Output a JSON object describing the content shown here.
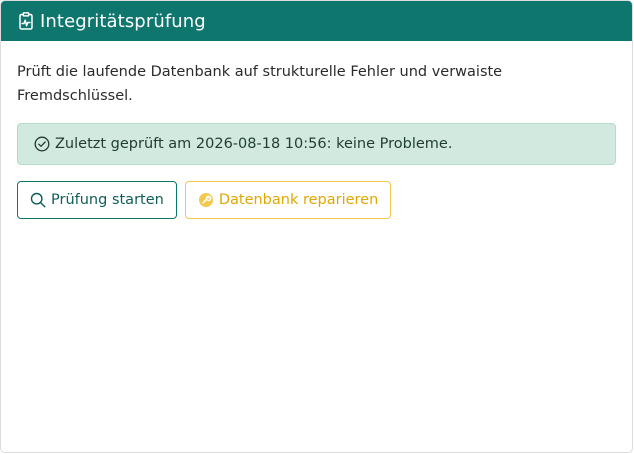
{
  "header": {
    "title": "Integritätsprüfung",
    "icon": "clipboard-pulse-icon",
    "background_color": "#0f766e"
  },
  "body": {
    "description": "Prüft die laufende Datenbank auf strukturelle Fehler und verwaiste Fremdschlüssel."
  },
  "status_alert": {
    "icon": "check-circle-icon",
    "text": "Zuletzt geprüft am 2026-08-18 10:56: keine Probleme.",
    "background_color": "#d1e9de"
  },
  "actions": {
    "start_check": {
      "label": "Prüfung starten",
      "icon": "search-icon",
      "color": "#0f766e"
    },
    "repair_db": {
      "label": "Datenbank reparieren",
      "icon": "wrench-coin-icon",
      "color": "#f2c94c"
    }
  }
}
